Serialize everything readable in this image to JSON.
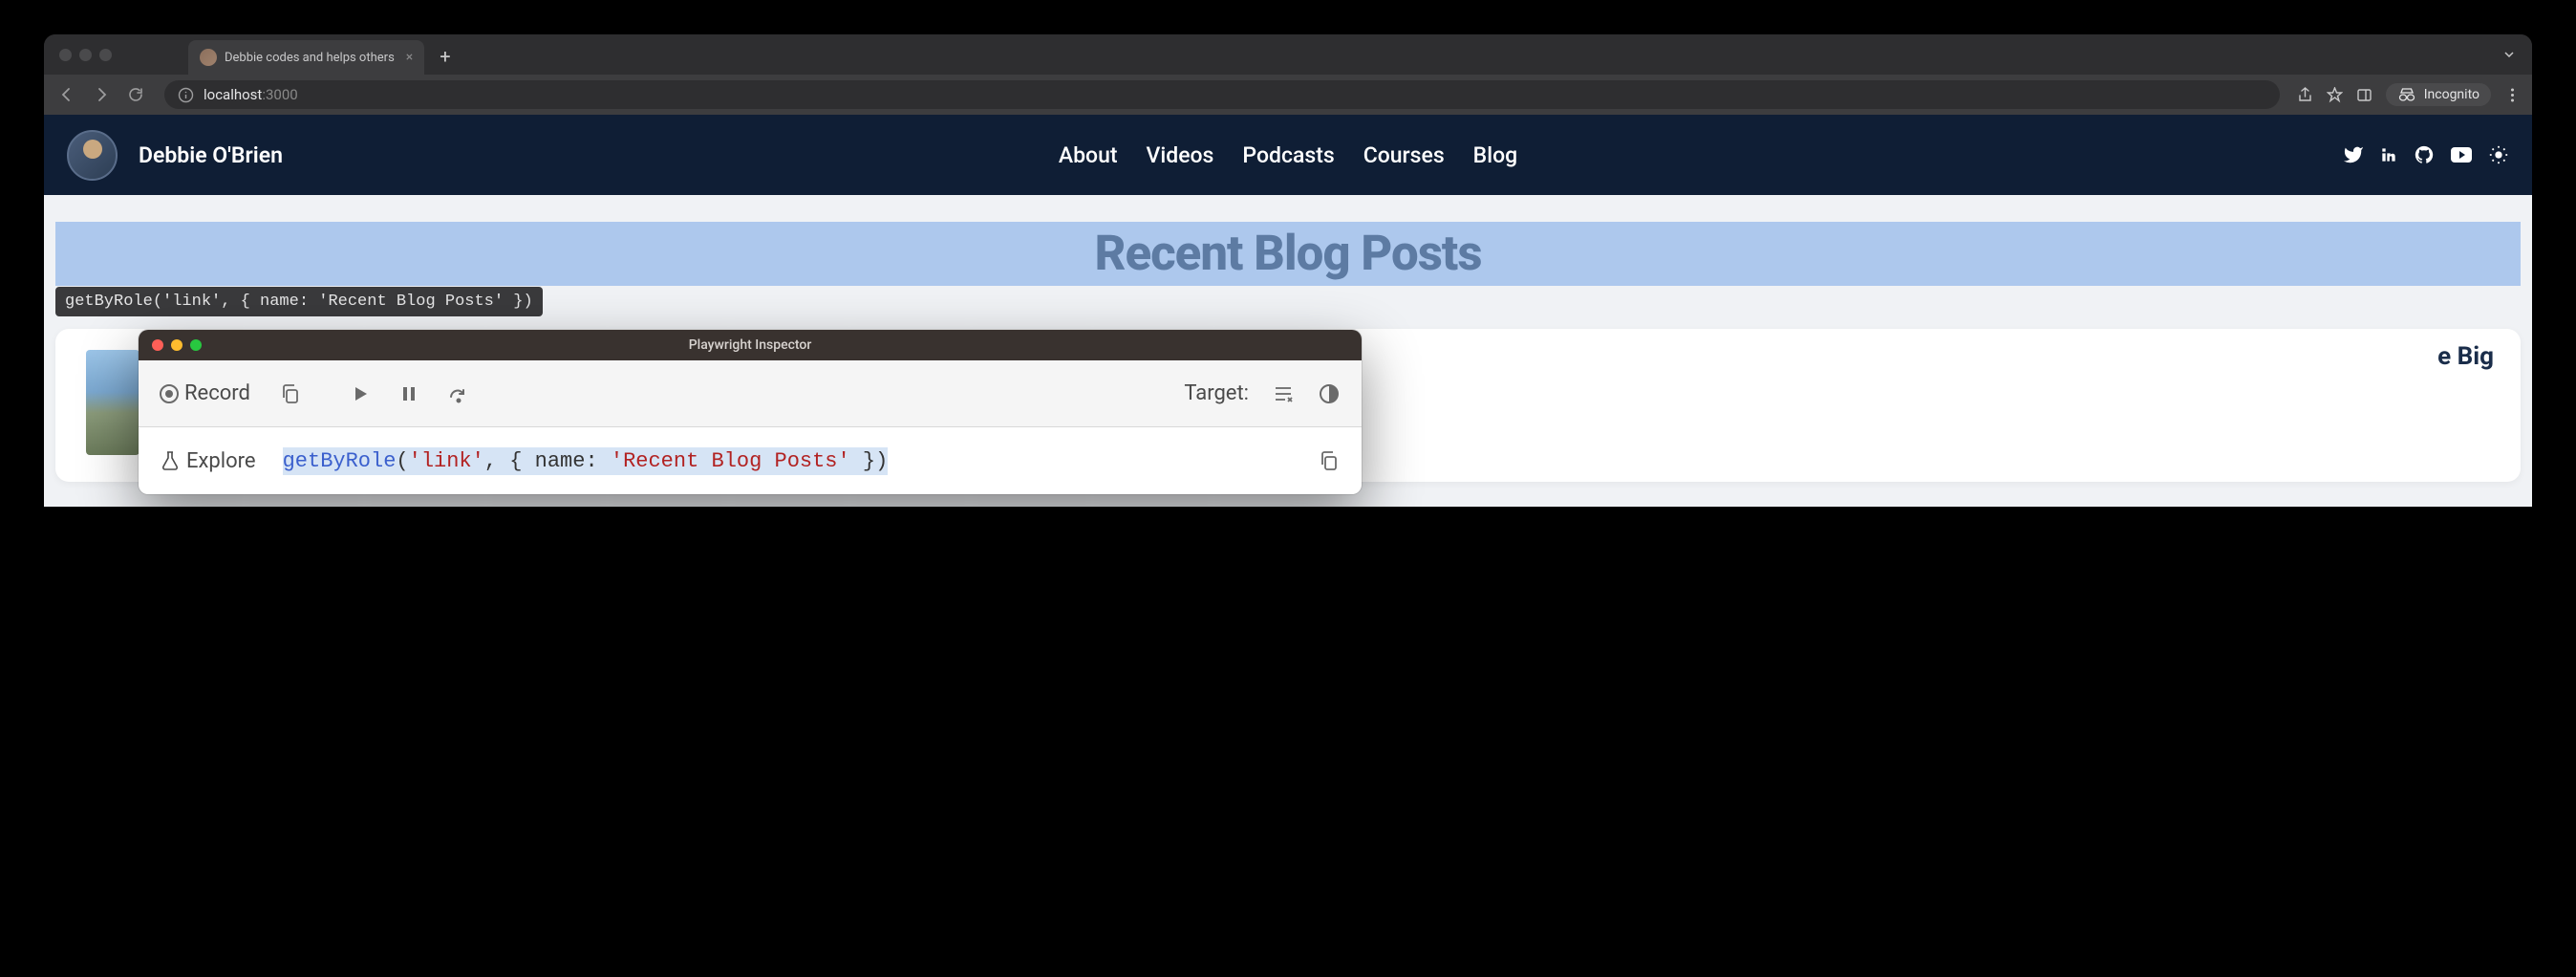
{
  "browser": {
    "tab": {
      "title": "Debbie codes and helps others"
    },
    "url": {
      "host": "localhost",
      "port": ":3000"
    },
    "incognito_label": "Incognito"
  },
  "site": {
    "name": "Debbie O'Brien",
    "nav": [
      "About",
      "Videos",
      "Podcasts",
      "Courses",
      "Blog"
    ]
  },
  "page": {
    "heading": "Recent Blog Posts",
    "partial_card_text": "e Big"
  },
  "tooltip": {
    "text": "getByRole('link', { name: 'Recent Blog Posts' })"
  },
  "inspector": {
    "title": "Playwright Inspector",
    "record_label": "Record",
    "target_label": "Target:",
    "explore_label": "Explore",
    "locator": {
      "func": "getByRole",
      "open": "(",
      "arg1": "'link'",
      "comma": ", { ",
      "key": "name",
      "colon": ": ",
      "arg2": "'Recent Blog Posts'",
      "close": " })"
    }
  }
}
